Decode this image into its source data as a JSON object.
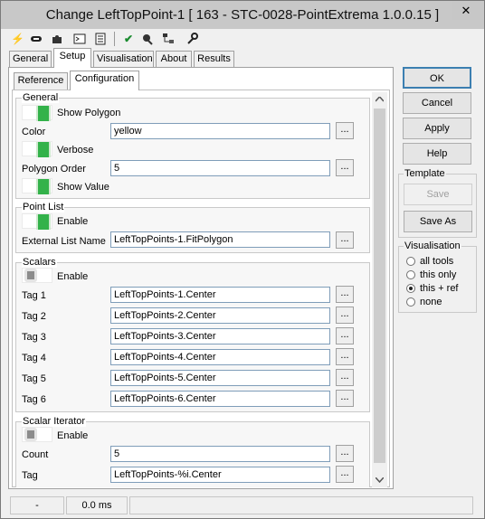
{
  "window": {
    "title": "Change LeftTopPoint-1 [ 163 - STC-0028-PointExtrema 1.0.0.15 ]",
    "close_glyph": "✕"
  },
  "toolbar": {
    "icons": [
      "lightning-icon",
      "link-icon",
      "puzzle-icon",
      "console-icon",
      "document-icon",
      "checkmark-icon",
      "camera-icon",
      "network-icon",
      "wrench-icon"
    ]
  },
  "tabs": [
    "General",
    "Setup",
    "Visualisation",
    "About",
    "Results"
  ],
  "subtabs": [
    "Reference",
    "Configuration"
  ],
  "general": {
    "title": "General",
    "show_polygon": "Show Polygon",
    "color_label": "Color",
    "color_value": "yellow",
    "verbose": "Verbose",
    "polygon_order_label": "Polygon Order",
    "polygon_order_value": "5",
    "show_value": "Show Value"
  },
  "point_list": {
    "title": "Point List",
    "enable": "Enable",
    "external_label": "External List Name",
    "external_value": "LeftTopPoints-1.FitPolygon"
  },
  "scalars": {
    "title": "Scalars",
    "enable": "Enable",
    "tags": [
      {
        "label": "Tag 1",
        "value": "LeftTopPoints-1.Center"
      },
      {
        "label": "Tag 2",
        "value": "LeftTopPoints-2.Center"
      },
      {
        "label": "Tag 3",
        "value": "LeftTopPoints-3.Center"
      },
      {
        "label": "Tag 4",
        "value": "LeftTopPoints-4.Center"
      },
      {
        "label": "Tag 5",
        "value": "LeftTopPoints-5.Center"
      },
      {
        "label": "Tag 6",
        "value": "LeftTopPoints-6.Center"
      }
    ]
  },
  "scalar_iterator": {
    "title": "Scalar Iterator",
    "enable": "Enable",
    "count_label": "Count",
    "count_value": "5",
    "tag_label": "Tag",
    "tag_value": "LeftTopPoints-%i.Center"
  },
  "dots_label": "...",
  "buttons": {
    "ok": "OK",
    "cancel": "Cancel",
    "apply": "Apply",
    "help": "Help"
  },
  "template": {
    "title": "Template",
    "save": "Save",
    "save_as": "Save As"
  },
  "visualisation": {
    "title": "Visualisation",
    "options": [
      "all tools",
      "this only",
      "this + ref",
      "none"
    ],
    "selected": "this + ref"
  },
  "status": {
    "cell1": "-",
    "cell2": "0.0 ms"
  }
}
